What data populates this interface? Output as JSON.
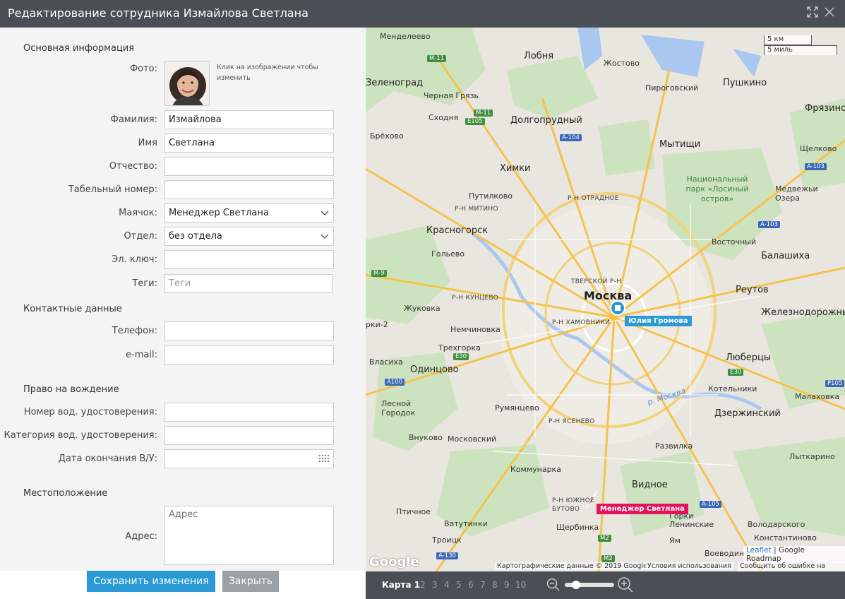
{
  "window": {
    "title": "Редактирование сотрудника Измайлова Светлана"
  },
  "sections": {
    "basic": "Основная информация",
    "contacts": "Контактные данные",
    "driving": "Право на вождение",
    "location": "Местоположение"
  },
  "fields": {
    "photo_label": "Фото:",
    "photo_hint": "Клик на изображении чтобы изменить",
    "lastname_label": "Фамилия:",
    "lastname_value": "Измайлова",
    "firstname_label": "Имя",
    "firstname_value": "Светлана",
    "patronymic_label": "Отчество:",
    "tab_number_label": "Табельный номер:",
    "beacon_label": "Маячок:",
    "beacon_value": "Менеджер Светлана",
    "department_label": "Отдел:",
    "department_value": "без отдела",
    "ekey_label": "Эл. ключ:",
    "tags_label": "Теги:",
    "tags_placeholder": "Теги",
    "phone_label": "Телефон:",
    "email_label": "e-mail:",
    "license_number_label": "Номер вод. удостоверения:",
    "license_category_label": "Категория вод. удостоверения:",
    "license_expiry_label": "Дата окончания В/У:",
    "address_label": "Адрес:",
    "address_placeholder": "Адрес"
  },
  "buttons": {
    "save": "Сохранить изменения",
    "close": "Закрыть"
  },
  "map": {
    "scale_km": "5 км",
    "scale_mi": "5 миль",
    "markers": {
      "blue_label": "Юлия Громова",
      "red_label": "Менеджер Светлана"
    },
    "attribution_data": "Картографические данные © 2019 Google",
    "attribution_terms": "Условия использования",
    "attribution_report": "Сообщить об ошибке на карте",
    "leaflet": "Leaflet",
    "roadmap": "Google Roadmap",
    "google": "Google",
    "labels": {
      "mendeleevo": "Менделеево",
      "lobnya": "Лобня",
      "zhostovo": "Жостово",
      "zelenograd": "Зеленоград",
      "chernaya_gryaz": "Черная Грязь",
      "pirogovsky": "Пироговский",
      "pushkino": "Пушкино",
      "fryazino": "Фрязино",
      "skhodnya": "Сходня",
      "dolgoprudny": "Долгопрудный",
      "brekhovo": "Брёхово",
      "mytishchi": "Мытищи",
      "shchelkovo": "Щелково",
      "khimki": "Химки",
      "park": "Национальный парк «Лосиный остров»",
      "putilkovo": "Путилково",
      "mitino": "Р-Н МИТИНО",
      "otradnoe": "Р-Н ОТРАДНОЕ",
      "medvezhi": "Медвежьи Озера",
      "krasnogorsk": "Красногорск",
      "vostochny": "Восточный",
      "goltsevo": "Гольево",
      "balashikha": "Балашиха",
      "tverskoy": "ТВЕРСКОЙ Р-Н",
      "moskva": "Москва",
      "reutov": "Реутов",
      "kuntsevo": "Р-Н КУНЦЕВО",
      "zhukovka": "Жуковка",
      "khamovniki": "Р-Н ХАМОВНИКИ",
      "zheleznodorozhny": "Железнодорожный",
      "rki2": "рки-2",
      "nemchinovka": "Немчиновка",
      "trekhgorka": "Трехгорка",
      "lyubertsy": "Люберцы",
      "vlasikha": "Власиха",
      "odintsovo": "Одинцово",
      "moskva_river": "р. Москва",
      "kotelniki": "Котельники",
      "lesnoy": "Лесной Городок",
      "rumyantsevo": "Румянцево",
      "dzerzhinsky": "Дзержинский",
      "malakhovka": "Малаховка",
      "yasenevo": "Р-Н ЯСЕНЕВО",
      "vnukovo": "Внуково",
      "moskovsky": "Московский",
      "razvilka": "Развилка",
      "lytkarino": "Лыткарино",
      "kommunarka": "Коммунарка",
      "vidnoe": "Видное",
      "butovo": "Р-Н ЮЖНОЕ БУТОВО",
      "ptichnoe": "Птичное",
      "gorki": "Горки Ленинские",
      "vatutinki": "Ватутинки",
      "shcherbinka": "Щербинка",
      "volodarskogo": "Володарского",
      "troitsk": "Троицк",
      "yam": "Ям",
      "konstantinovo": "Константиново",
      "voevodino": "Воеводин"
    },
    "roads": {
      "m11": "M-11",
      "m11b": "M-11",
      "e105": "E105",
      "a104": "A-104",
      "a103": "A-103",
      "a103b": "A-103",
      "m9": "M-9",
      "e30": "E30",
      "e30b": "E30",
      "a100": "A100",
      "p105": "P105",
      "a105": "A-105",
      "m2": "M2",
      "m2b": "M2",
      "a130": "A-130"
    }
  },
  "mapbar": {
    "current": "Карта 1",
    "pages": [
      "2",
      "3",
      "4",
      "5",
      "6",
      "7",
      "8",
      "9",
      "10"
    ]
  },
  "colors": {
    "accent": "#2a9ad6",
    "titlebar": "#4a4f55",
    "marker_red": "#e2125f"
  }
}
